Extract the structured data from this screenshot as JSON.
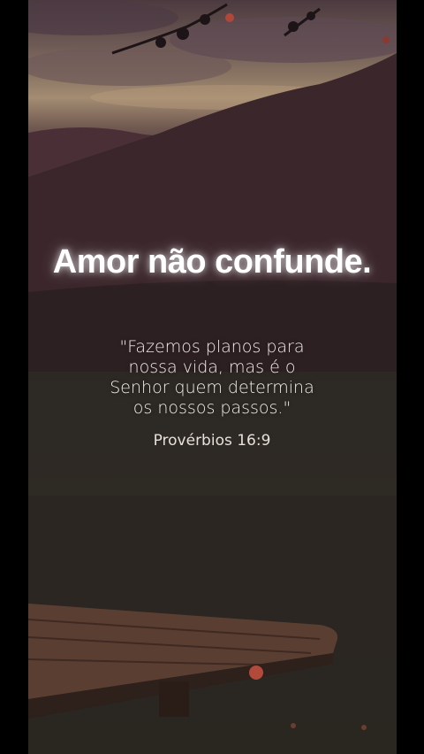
{
  "headline": "Amor não confunde.",
  "verse": {
    "lines": [
      "\"Fazemos planos para",
      "nossa vida, mas é o",
      "Senhor quem determina",
      "os nossos passos.\""
    ]
  },
  "reference": "Provérbios 16:9",
  "colors": {
    "text": "#ffffff",
    "sky": "#a38c72",
    "mountain": "#3a262b",
    "water": "#2e2a25",
    "dock": "#5a3e32"
  }
}
